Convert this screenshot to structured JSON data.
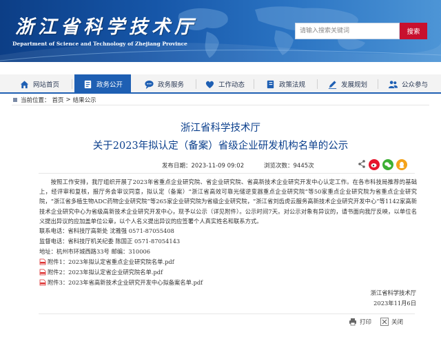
{
  "header": {
    "site_title": "浙江省科学技术厅",
    "site_subtitle": "Department of Science and Technology of Zhejiang Province",
    "search_placeholder": "请输入搜索关键词",
    "search_button": "搜索",
    "colors": {
      "banner": "#1656a8",
      "search_button": "#c8102e"
    }
  },
  "nav": {
    "items": [
      {
        "label": "网站首页",
        "icon": "home-icon"
      },
      {
        "label": "政务公开",
        "icon": "document-icon",
        "active": true
      },
      {
        "label": "政务服务",
        "icon": "chat-icon"
      },
      {
        "label": "工作动态",
        "icon": "heart-icon"
      },
      {
        "label": "政策法规",
        "icon": "book-icon"
      },
      {
        "label": "发展规划",
        "icon": "pen-icon"
      },
      {
        "label": "公众参与",
        "icon": "people-icon"
      }
    ],
    "active_color": "#1e5fb3"
  },
  "breadcrumb": {
    "label": "当前位置：",
    "home": "首页",
    "separator": ">",
    "current": "结果公示"
  },
  "article": {
    "org": "浙江省科学技术厅",
    "title": "关于2023年拟认定（备案）省级企业研发机构名单的公示",
    "publish_date": "发布日期：2023-11-09 09:02",
    "views": "浏览次数：9445次",
    "share_icons": [
      "share-icon",
      "weibo-icon",
      "wechat-icon",
      "qq-icon"
    ],
    "body": "按照工作安排，我厅组织开展了2023年省重点企业研究院、省企业研究院、省高新技术企业研究开发中心认定工作。在各市科技局推荐的基础上，经评审和复核，报厅务会审议同意，拟认定（备案）“浙江省高效可靠光储逆变器重点企业研究院”等50家重点企业研究院为省重点企业研究院，“浙江省多植生物ADC药物企业研究院”等265家企业研究院为省级企业研究院，“浙江省刘齿虎云服务高新技术企业研究开发中心”等1142家高新技术企业研究中心为省级高新技术企业研究开发中心，现予以公示（详见附件）。公示时间7天。对公示对象有异议的，请书面向我厅反映，以单位名义提出异议的应加盖单位公章，以个人名义提出异议的应签署个人真实姓名和联系方式。",
    "contact": "联系电话：省科技厅高新处    沈雅强 0571-87055408",
    "supervise": "监督电话：省科技厅机关纪委  陈国正 0571-87054143",
    "address": "地址：杭州市环城西路33号    邮编：310006",
    "attachments": [
      "附件1：2023年拟认定省重点企业研究院名单.pdf",
      "附件2：2023年拟认定省企业研究院名单.pdf",
      "附件3：2023年省高新技术企业研究开发中心拟备案名单.pdf"
    ],
    "sign_org": "浙江省科学技术厅",
    "sign_date": "2023年11月6日"
  },
  "tools": {
    "print": "打印",
    "close": "关闭"
  }
}
